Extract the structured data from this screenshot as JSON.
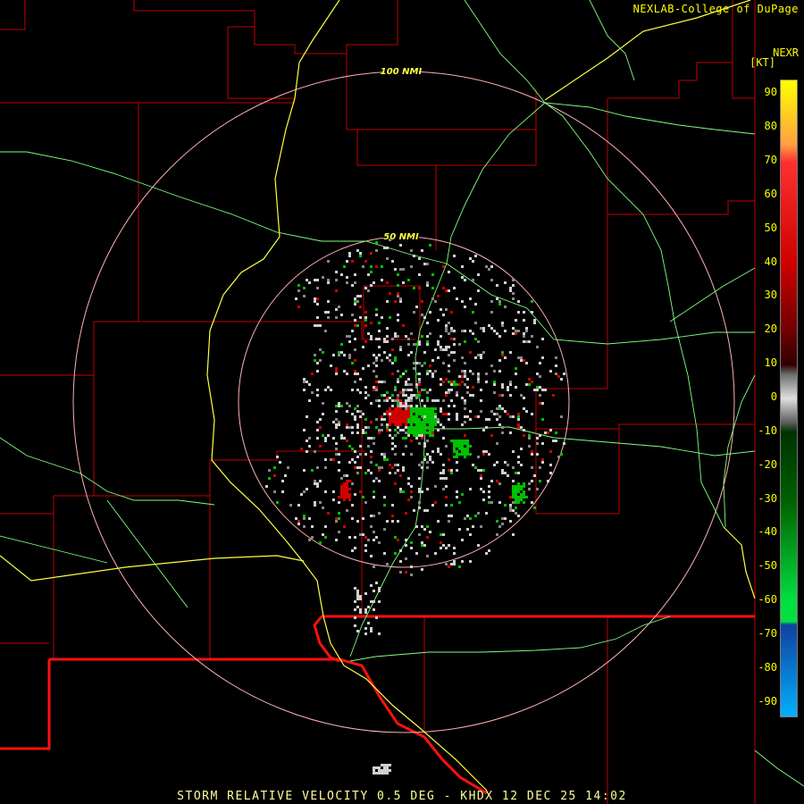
{
  "credit": "NEXLAB-College of DuPage",
  "product": {
    "code": "NEXR",
    "units": "[KT]"
  },
  "rings": [
    {
      "label": "100 NMI"
    },
    {
      "label": "50 NMI"
    }
  ],
  "caption": "STORM RELATIVE VELOCITY 0.5 DEG - KHDX 12 DEC 25 14:02",
  "scale": {
    "ticks": [
      "90",
      "80",
      "70",
      "60",
      "50",
      "40",
      "30",
      "20",
      "10",
      "0",
      "-10",
      "-20",
      "-30",
      "-40",
      "-50",
      "-60",
      "-70",
      "-80",
      "-90"
    ],
    "stops": [
      {
        "value": 94,
        "color": "#ffff00"
      },
      {
        "value": 75,
        "color": "#ffa040"
      },
      {
        "value": 70,
        "color": "#ff3030"
      },
      {
        "value": 40,
        "color": "#d00000"
      },
      {
        "value": 20,
        "color": "#700000"
      },
      {
        "value": 10,
        "color": "#300000"
      },
      {
        "value": 7,
        "color": "#707070"
      },
      {
        "value": 0,
        "color": "#e0e0e0"
      },
      {
        "value": -7,
        "color": "#606060"
      },
      {
        "value": -10,
        "color": "#003000"
      },
      {
        "value": -30,
        "color": "#006000"
      },
      {
        "value": -60,
        "color": "#00e040"
      },
      {
        "value": -66,
        "color": "#00e040"
      },
      {
        "value": -67,
        "color": "#1040a0"
      },
      {
        "value": -94,
        "color": "#00b0ff"
      }
    ]
  },
  "colors": {
    "background": "#000000",
    "county_lines": "#c00000",
    "state_line": "#ff1010",
    "highways": "#ffff40",
    "rivers": "#80ff80",
    "range_rings": "#ffb0b0",
    "text": "#ffff00",
    "outbound": "#d00000",
    "inbound": "#00c000",
    "near_zero": "#d0d0d0"
  }
}
